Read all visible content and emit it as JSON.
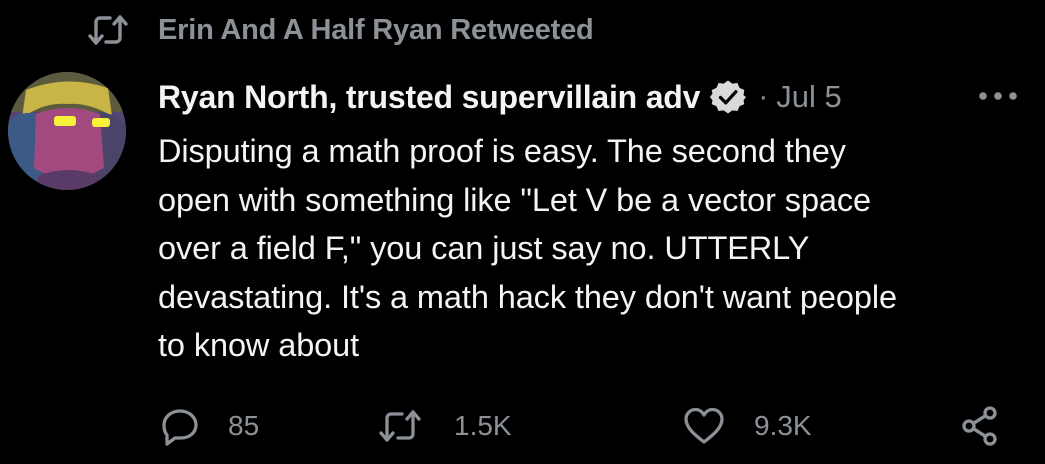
{
  "retweet_header": {
    "icon": "retweet-icon",
    "text": "Erin And A Half Ryan Retweeted"
  },
  "tweet": {
    "avatar": "avatar-illustration",
    "author_name": "Ryan North, trusted supervillain adv",
    "verified_icon": "verified-badge-icon",
    "separator": "·",
    "date": "Jul 5",
    "more_icon": "more-options-icon",
    "body": "Disputing a math proof is easy.  The second they\nopen with something like \"Let V be a vector space\nover a field F,\" you can just say no. UTTERLY\ndevastating.  It's a math hack they don't want people\nto know about"
  },
  "actions": {
    "reply": {
      "icon": "reply-icon",
      "count": "85"
    },
    "retweet": {
      "icon": "retweet-icon",
      "count": "1.5K"
    },
    "like": {
      "icon": "heart-icon",
      "count": "9.3K"
    },
    "share": {
      "icon": "share-icon"
    }
  },
  "colors": {
    "background": "#000000",
    "primary_text": "#f2f4f5",
    "secondary_text": "#8b9197"
  }
}
